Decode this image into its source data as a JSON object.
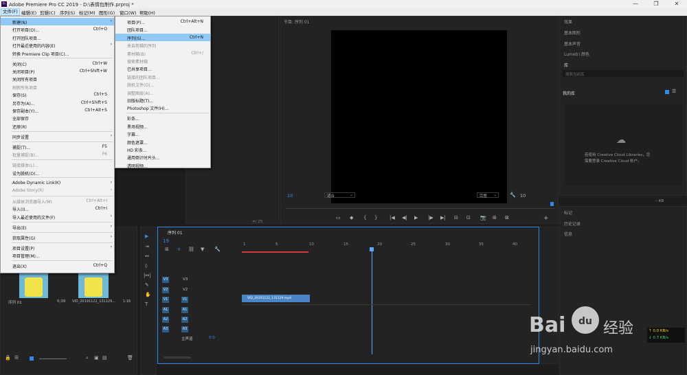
{
  "window": {
    "title": "Adobe Premiere Pro CC 2019 - D:\\表情包制作.prproj *",
    "app_badge": "Pr",
    "controls": [
      "—",
      "❐",
      "✕"
    ]
  },
  "menubar": {
    "items": [
      "文件(F)",
      "编辑(E)",
      "剪辑(C)",
      "序列(S)",
      "标记(M)",
      "图形(G)",
      "窗口(W)",
      "帮助(H)"
    ]
  },
  "file_menu": {
    "items": [
      {
        "label": "新建(N)",
        "shortcut": "",
        "submenu": true,
        "state": "highlighted"
      },
      {
        "label": "打开项目(O)...",
        "shortcut": "Ctrl+O"
      },
      {
        "label": "打开团队项目...",
        "shortcut": ""
      },
      {
        "label": "打开最近使用的内容(E)",
        "shortcut": "",
        "submenu": true
      },
      {
        "label": "转换 Premiere Clip 项目(C)...",
        "shortcut": ""
      },
      {
        "sep": true
      },
      {
        "label": "关闭(C)",
        "shortcut": "Ctrl+W"
      },
      {
        "label": "关闭项目(P)",
        "shortcut": "Ctrl+Shift+W"
      },
      {
        "label": "关闭所有项目",
        "shortcut": ""
      },
      {
        "label": "刷新所有项目",
        "shortcut": "",
        "disabled": true
      },
      {
        "label": "保存(S)",
        "shortcut": "Ctrl+S"
      },
      {
        "label": "另存为(A)...",
        "shortcut": "Ctrl+Shift+S"
      },
      {
        "label": "保存副本(Y)...",
        "shortcut": "Ctrl+Alt+S"
      },
      {
        "label": "全部保存",
        "shortcut": ""
      },
      {
        "label": "还原(R)",
        "shortcut": ""
      },
      {
        "sep": true
      },
      {
        "label": "同步设置",
        "shortcut": "",
        "submenu": true
      },
      {
        "sep": true
      },
      {
        "label": "捕捉(T)...",
        "shortcut": "F5"
      },
      {
        "label": "批量捕捉(B)...",
        "shortcut": "F6",
        "disabled": true
      },
      {
        "sep": true
      },
      {
        "label": "链接媒体(L)...",
        "shortcut": "",
        "disabled": true
      },
      {
        "label": "设为脱机(O)...",
        "shortcut": ""
      },
      {
        "sep": true
      },
      {
        "label": "Adobe Dynamic Link(K)",
        "shortcut": "",
        "submenu": true
      },
      {
        "label": "Adobe Story(R)",
        "shortcut": "",
        "submenu": true,
        "disabled": true
      },
      {
        "sep": true
      },
      {
        "label": "从媒体浏览器导入(M)",
        "shortcut": "Ctrl+Alt+I",
        "disabled": true
      },
      {
        "label": "导入(I)...",
        "shortcut": "Ctrl+I"
      },
      {
        "label": "导入最近使用的文件(F)",
        "shortcut": "",
        "submenu": true
      },
      {
        "sep": true
      },
      {
        "label": "导出(E)",
        "shortcut": "",
        "submenu": true
      },
      {
        "sep": true
      },
      {
        "label": "获取属性(G)",
        "shortcut": "",
        "submenu": true
      },
      {
        "sep": true
      },
      {
        "label": "项目设置(P)",
        "shortcut": "",
        "submenu": true
      },
      {
        "label": "项目管理(M)...",
        "shortcut": ""
      },
      {
        "sep": true
      },
      {
        "label": "退出(X)",
        "shortcut": "Ctrl+Q"
      }
    ]
  },
  "new_submenu": {
    "items": [
      {
        "label": "项目(P)...",
        "shortcut": "Ctrl+Alt+N"
      },
      {
        "label": "团队项目...",
        "shortcut": ""
      },
      {
        "label": "序列(S)...",
        "shortcut": "Ctrl+N",
        "state": "highlighted"
      },
      {
        "label": "来自剪辑的序列",
        "shortcut": "",
        "disabled": true
      },
      {
        "label": "素材箱(B)",
        "shortcut": "Ctrl+/",
        "disabled": true
      },
      {
        "label": "搜索素材箱",
        "shortcut": "",
        "disabled": true
      },
      {
        "label": "已共享项目...",
        "shortcut": ""
      },
      {
        "label": "链接的团队项目...",
        "shortcut": "",
        "disabled": true
      },
      {
        "label": "脱机文件(O)...",
        "shortcut": "",
        "disabled": true
      },
      {
        "label": "调整图层(A)...",
        "shortcut": "",
        "disabled": true
      },
      {
        "label": "旧版标题(T)...",
        "shortcut": ""
      },
      {
        "label": "Photoshop 文件(H)...",
        "shortcut": ""
      },
      {
        "sep": true
      },
      {
        "label": "彩条...",
        "shortcut": ""
      },
      {
        "label": "黑场视频...",
        "shortcut": ""
      },
      {
        "label": "字幕...",
        "shortcut": ""
      },
      {
        "label": "颜色遮罩...",
        "shortcut": ""
      },
      {
        "label": "HD 彩条...",
        "shortcut": ""
      },
      {
        "label": "通用倒计时片头...",
        "shortcut": ""
      },
      {
        "label": "透明视频...",
        "shortcut": ""
      }
    ]
  },
  "program_monitor": {
    "tab": "节目: 序列 01",
    "timecode_left": "10",
    "fit_label": "适合",
    "quality_label": "完整",
    "timecode_right": "10",
    "transport": [
      "▭",
      "◆",
      "{",
      "}",
      "|◀",
      "◀|",
      "▶",
      "|▶",
      "▶|",
      "⊟",
      "⊡",
      "📷",
      "⊞",
      "⊠"
    ],
    "add_button": "+",
    "source_counter": "≠/ 25"
  },
  "right_panel": {
    "tabs": [
      "效果",
      "基本图形",
      "基本声音",
      "Lumetri 颜色",
      "库"
    ],
    "search_placeholder": "搜索当前库",
    "library_dropdown": "我的库",
    "library_view": "我的库",
    "cc_message_line1": "若使用 Creative Cloud Libraries，您",
    "cc_message_line2": "需要登录 Creative Cloud 帐户。",
    "size_readout": "-- KB",
    "bottom_tabs": [
      "标记",
      "历史记录",
      "信息"
    ]
  },
  "project_panel": {
    "items": [
      {
        "name": "序列 01",
        "duration": "0;39"
      },
      {
        "name": "VID_20191122_131129...",
        "duration": "1:16"
      }
    ]
  },
  "timeline": {
    "tab": "序列 01",
    "timecode": "19",
    "ruler": [
      "1",
      "5",
      "10",
      "15",
      "20",
      "25",
      "30",
      "35",
      "40"
    ],
    "video_tracks": [
      "V3",
      "V2",
      "V1"
    ],
    "audio_tracks": [
      "A1",
      "A2",
      "A3"
    ],
    "master_label": "主声道",
    "master_value": "0.0",
    "clip_label": "VID_20191122_131129.mp4"
  },
  "tools": [
    "▶",
    "⇥",
    "↔",
    "◊",
    "|↔|",
    "✎",
    "✋",
    "T"
  ],
  "overlay": {
    "net_up": "0.0 KB/s",
    "net_down": "0.7 KB/s",
    "watermark_brand": "Bai",
    "watermark_paw": "du",
    "watermark_cn": "经验",
    "watermark_url": "jingyan.baidu.com"
  },
  "colors": {
    "accent_blue": "#2d8ceb",
    "playhead": "#5aa8ff",
    "workarea_red": "#d63a3a",
    "clip_blue": "#4a86c5",
    "highlight": "#91c9f7"
  }
}
